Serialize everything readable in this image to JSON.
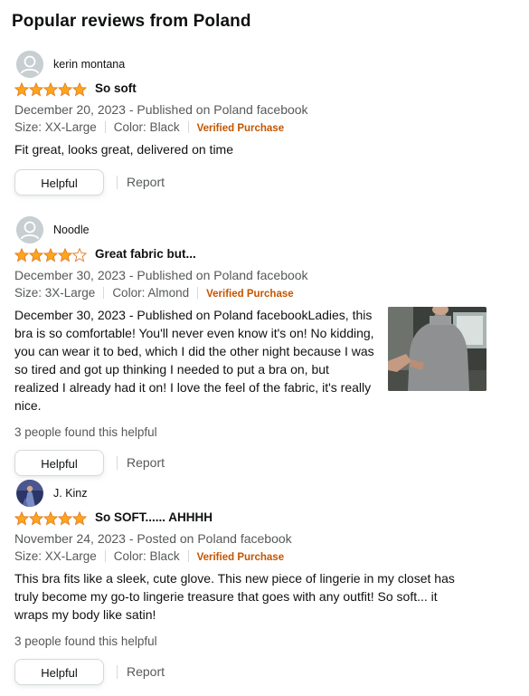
{
  "section_title": "Popular reviews from Poland",
  "colors": {
    "star": "#FFA41C",
    "verified": "#C45500",
    "muted": "#565959"
  },
  "reviews": [
    {
      "reviewer": "kerin montana",
      "avatar_icon": "default-user-avatar-icon",
      "rating": 5,
      "title": "So soft",
      "date_line": "December 20, 2023 - Published on Poland facebook",
      "size": "Size: XX-Large",
      "color": "Color: Black",
      "verified": "Verified Purchase",
      "body": "Fit great, looks great, delivered on time",
      "helpful_count": "",
      "helpful_label": "Helpful",
      "report_label": "Report"
    },
    {
      "reviewer": "Noodle",
      "avatar_icon": "default-user-avatar-icon",
      "rating": 4,
      "title": "Great fabric but...",
      "date_line": "December 30, 2023 - Published on Poland facebook",
      "size": "Size: 3X-Large",
      "color": "Color: Almond",
      "verified": "Verified Purchase",
      "body": "December 30, 2023 - Published on Poland facebookLadies, this bra is so comfortable! You'll never even know it's on! No kidding, you can wear it to bed, which I did the other night because I was so tired and got up thinking I needed to put a bra on, but realized I already had it on! I love the feel of the fabric, it's really nice.",
      "helpful_count": "3 people found this helpful",
      "helpful_label": "Helpful",
      "report_label": "Report"
    },
    {
      "reviewer": "J. Kinz",
      "avatar_icon": "custom-photo-avatar-icon",
      "rating": 5,
      "title": "So SOFT...... AHHHH",
      "date_line": "November 24, 2023 - Posted on Poland facebook",
      "size": "Size: XX-Large",
      "color": "Color: Black",
      "verified": "Verified Purchase",
      "body": "This bra fits like a sleek, cute glove. This new piece of lingerie in my closet has truly become my go-to lingerie treasure that goes with any outfit! So soft... it wraps my body like satin!",
      "helpful_count": "3 people found this helpful",
      "helpful_label": "Helpful",
      "report_label": "Report"
    }
  ]
}
